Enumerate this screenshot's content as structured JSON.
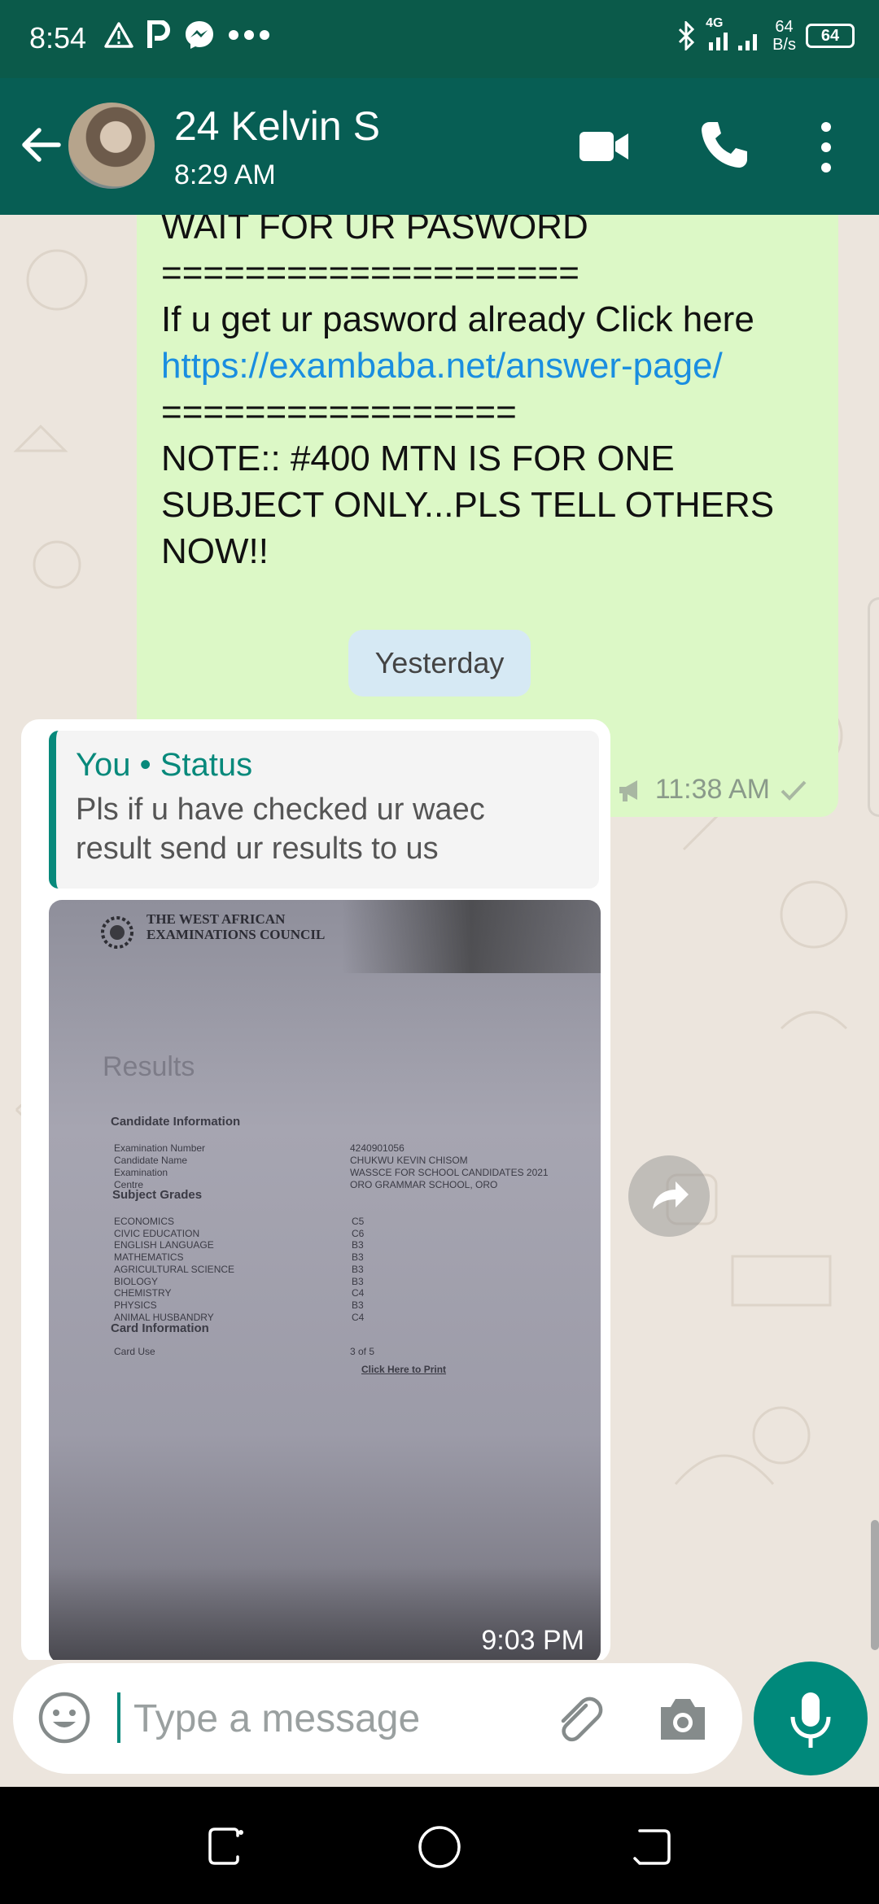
{
  "status_bar": {
    "time": "8:54",
    "left_icons": [
      "warning-icon",
      "parking-icon",
      "messenger-icon",
      "more-dots-icon"
    ],
    "network_label": "4G",
    "net_speed_value": "64",
    "net_speed_unit": "B/s",
    "battery": "64"
  },
  "header": {
    "contact_name": "24 Kelvin S",
    "last_seen": "8:29 AM",
    "icons": [
      "back-arrow-icon",
      "video-call-icon",
      "voice-call-icon",
      "more-vert-icon"
    ]
  },
  "messages": {
    "outgoing": {
      "lines": [
        "WAIT FOR UR PASWORD",
        "====================",
        "If u get ur pasword already Click here",
        "https://exambaba.net/answer-page/",
        "=================",
        "NOTE:: #400 MTN IS FOR ONE",
        "SUBJECT ONLY...PLS TELL OTHERS",
        "NOW!!"
      ],
      "time": "11:38 AM"
    },
    "date_separator": "Yesterday",
    "incoming": {
      "quote_author": "You • Status",
      "quote_line1": "Pls if u have checked ur waec",
      "quote_line2": "result send ur results to us",
      "time": "9:03 PM",
      "photo": {
        "council_line1": "THE WEST AFRICAN",
        "council_line2": "EXAMINATIONS COUNCIL",
        "heading": "Results",
        "candidate_section": "Candidate Information",
        "candidate_rows": [
          {
            "label": "Examination Number",
            "value": "4240901056"
          },
          {
            "label": "Candidate Name",
            "value": "CHUKWU KEVIN CHISOM"
          },
          {
            "label": "Examination",
            "value": "WASSCE FOR SCHOOL CANDIDATES 2021"
          },
          {
            "label": "Centre",
            "value": "ORO GRAMMAR SCHOOL, ORO"
          }
        ],
        "grades_section": "Subject Grades",
        "grades": [
          {
            "subject": "ECONOMICS",
            "grade": "C5"
          },
          {
            "subject": "CIVIC EDUCATION",
            "grade": "C6"
          },
          {
            "subject": "ENGLISH LANGUAGE",
            "grade": "B3"
          },
          {
            "subject": "MATHEMATICS",
            "grade": "B3"
          },
          {
            "subject": "AGRICULTURAL SCIENCE",
            "grade": "B3"
          },
          {
            "subject": "BIOLOGY",
            "grade": "B3"
          },
          {
            "subject": "CHEMISTRY",
            "grade": "C4"
          },
          {
            "subject": "PHYSICS",
            "grade": "B3"
          },
          {
            "subject": "ANIMAL HUSBANDRY",
            "grade": "C4"
          }
        ],
        "card_section": "Card Information",
        "card_use_label": "Card Use",
        "card_use_value": "3 of 5",
        "print_link": "Click Here to Print"
      }
    }
  },
  "composer": {
    "placeholder": "Type a message",
    "icons": [
      "emoji-icon",
      "paperclip-icon",
      "camera-icon",
      "microphone-icon"
    ]
  },
  "nav": {
    "icons": [
      "recents-icon",
      "home-icon",
      "back-icon"
    ]
  },
  "colors": {
    "header": "#075e54",
    "status_bar": "#0b5a4a",
    "chat_bg": "#ece5dd",
    "outgoing_bubble": "#dcf8c6",
    "accent": "#00897b",
    "link": "#1a8ee0"
  }
}
